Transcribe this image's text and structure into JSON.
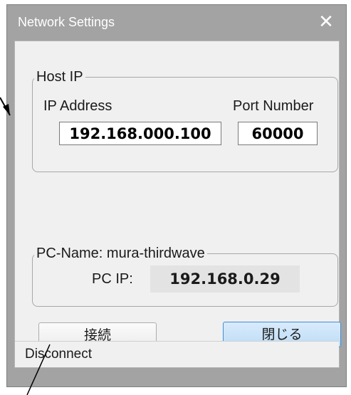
{
  "window": {
    "title": "Network Settings",
    "close_icon": "close-icon"
  },
  "host_group": {
    "legend": "Host IP",
    "ip_label": "IP Address",
    "ip_value": "192.168.000.100",
    "port_label": "Port Number",
    "port_value": "60000"
  },
  "pc_group": {
    "legend": "PC-Name: mura-thirdwave",
    "pc_ip_label": "PC IP:",
    "pc_ip_value": "192.168.0.29"
  },
  "buttons": {
    "connect_label": "接続",
    "close_label": "閉じる"
  },
  "status_bar": {
    "text": "Disconnect"
  }
}
